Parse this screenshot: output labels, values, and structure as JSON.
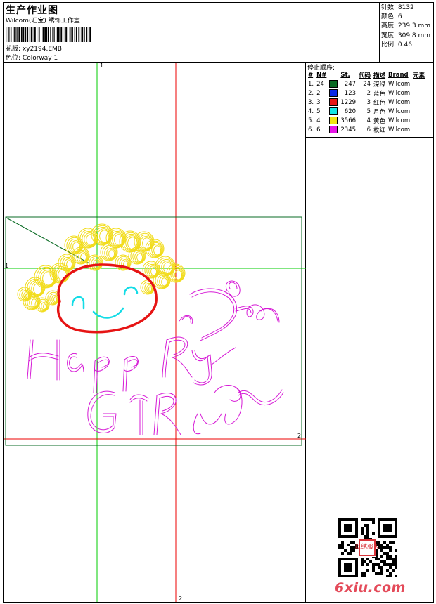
{
  "header": {
    "title": "生产作业图",
    "studio": "Wilcom(汇宝) 绣饰工作室",
    "design_label": "花版:",
    "design_value": "xy2194.EMB",
    "colorway_label": "色位:",
    "colorway_value": "Colorway 1"
  },
  "stats": {
    "stitches": "针数: 8132",
    "colors": "颜色: 6",
    "height": "高度: 239.3 mm",
    "width": "宽度: 309.8 mm",
    "scale": "比例: 0.46"
  },
  "stop_sequence": {
    "title": "停止顺序:",
    "headers": [
      "#",
      "N#",
      "St.",
      "代码",
      "描述",
      "Brand",
      "元素"
    ],
    "rows": [
      {
        "idx": "1.",
        "n": "24",
        "color": "#0a6b24",
        "st": "247",
        "code": "24",
        "desc": "深绿",
        "brand": "Wilcom"
      },
      {
        "idx": "2.",
        "n": "2",
        "color": "#0a28e6",
        "st": "123",
        "code": "2",
        "desc": "蓝色",
        "brand": "Wilcom"
      },
      {
        "idx": "3.",
        "n": "3",
        "color": "#e61414",
        "st": "1229",
        "code": "3",
        "desc": "红色",
        "brand": "Wilcom"
      },
      {
        "idx": "4.",
        "n": "5",
        "color": "#14e6e6",
        "st": "620",
        "code": "5",
        "desc": "月色",
        "brand": "Wilcom"
      },
      {
        "idx": "5.",
        "n": "4",
        "color": "#f0e614",
        "st": "3566",
        "code": "4",
        "desc": "黄色",
        "brand": "Wilcom"
      },
      {
        "idx": "6.",
        "n": "6",
        "color": "#e614e6",
        "st": "2345",
        "code": "6",
        "desc": "枚红",
        "brand": "Wilcom"
      }
    ]
  },
  "canvas": {
    "guide_label_1_top": "1",
    "guide_label_1_left": "1",
    "guide_label_2_bottom": "2",
    "guide_label_2_right": "2"
  },
  "watermark": {
    "site": "6xiu.com",
    "seal": "以绣服天"
  }
}
